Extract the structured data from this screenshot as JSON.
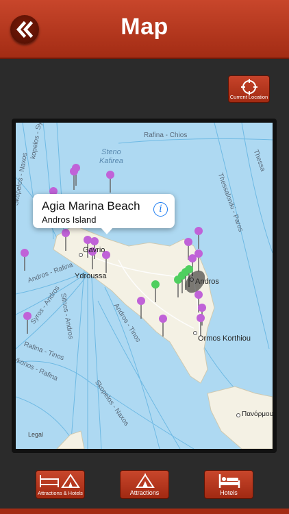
{
  "header": {
    "title": "Map",
    "back_icon": "double-chevron-left-icon"
  },
  "current_location": {
    "label": "Current Location",
    "icon": "crosshair-icon"
  },
  "map": {
    "labels": {
      "rafina_chios": "Rafina - Chios",
      "steno": "Steno",
      "kafirea": "Kafirea",
      "thessaloniki_paros": "Thessaloniki - Paros",
      "thessa": "Thessa",
      "skopelos_naxos_left": "Skopelos - Naxos",
      "kopelos_syros": "kopelos - Syros",
      "gavrio": "Gavrio",
      "ydroussa": "Ydroussa",
      "andros_rafina": "Andros - Rafina",
      "syros_andros": "Syros - Andros",
      "sifnos_andros": "Sifnos - Andros",
      "andros_tinos": "Andros - Tinos",
      "rafina_tinos": "Rafina - Tinos",
      "mykonos_rafina": "ykonos - Rafina",
      "andros": "Andros",
      "ormos_korthiou": "Ormos Korthiou",
      "skopelos_naxos": "Skopelos - Naxos",
      "panormos": "Πανόρμου",
      "legal": "Legal"
    },
    "callout": {
      "title": "Agia Marina Beach",
      "subtitle": "Andros Island",
      "info_icon": "info-icon"
    },
    "pin_colors": {
      "attraction": "#c062d8",
      "hotel": "#4fcf5f"
    }
  },
  "tabs": [
    {
      "label": "Attractions & Hotels",
      "icon": "bed-and-tent-icon"
    },
    {
      "label": "Attractions",
      "icon": "tent-icon"
    },
    {
      "label": "Hotels",
      "icon": "bed-icon"
    }
  ]
}
